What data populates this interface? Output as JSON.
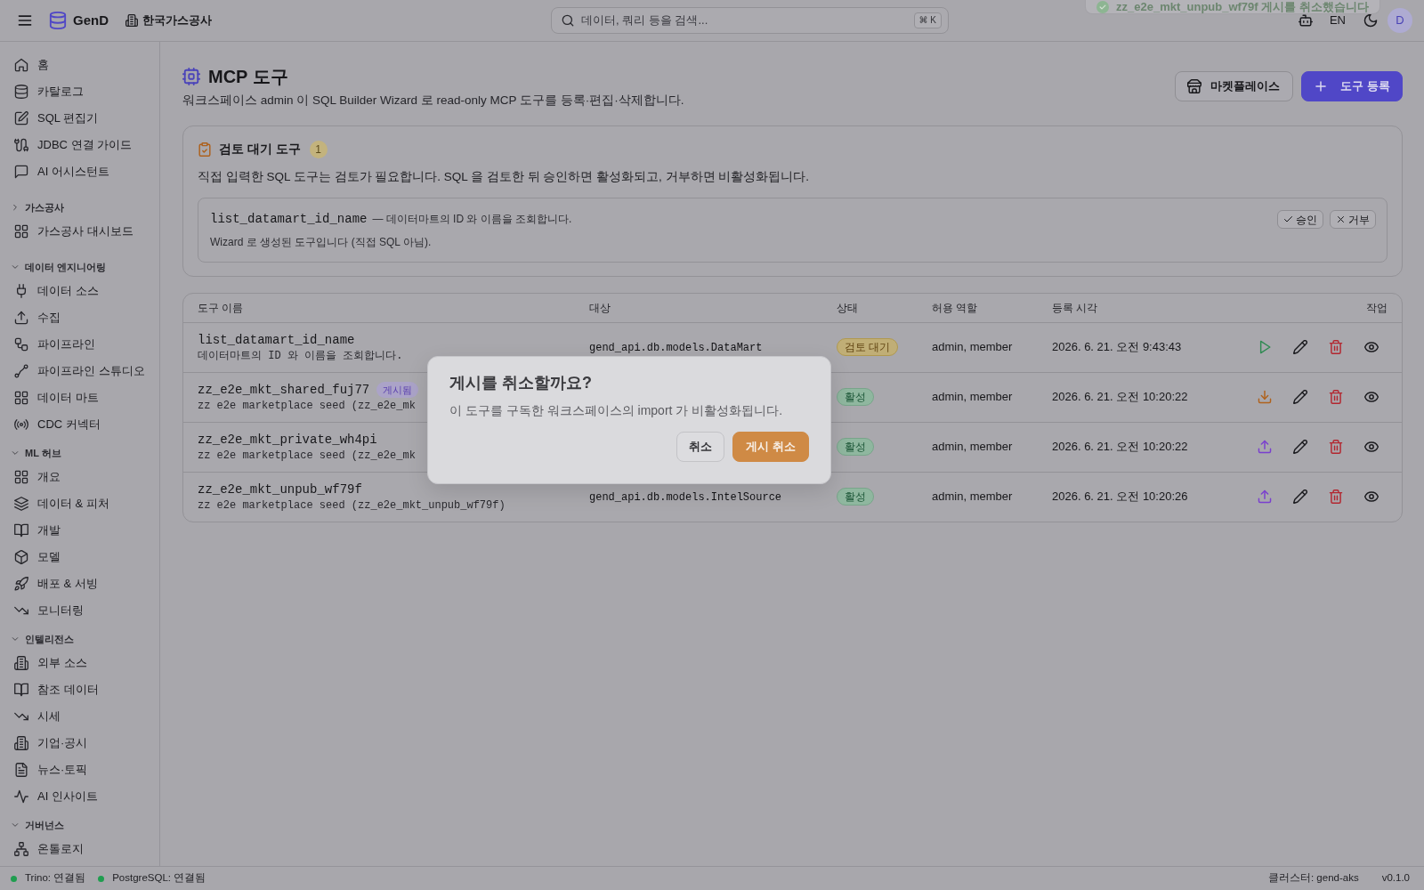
{
  "header": {
    "brand": "GenD",
    "organization": "한국가스공사",
    "search": {
      "placeholder": "데이터, 쿼리 등을 검색...",
      "shortcut": "⌘ K"
    },
    "language": "EN",
    "avatar": "D"
  },
  "toast": {
    "message": "zz_e2e_mkt_unpub_wf79f 게시를 취소했습니다"
  },
  "sidebar": {
    "groups": [
      {
        "items": [
          "홈",
          "카탈로그",
          "SQL 편집기",
          "JDBC 연결 가이드",
          "AI 어시스턴트"
        ]
      },
      {
        "title": "가스공사",
        "expanded": false,
        "items": [
          "가스공사 대시보드"
        ]
      },
      {
        "title": "데이터 엔지니어링",
        "expanded": true,
        "items": [
          "데이터 소스",
          "수집",
          "파이프라인",
          "파이프라인 스튜디오",
          "데이터 마트",
          "CDC 커넥터"
        ]
      },
      {
        "title": "ML 허브",
        "expanded": true,
        "items": [
          "개요",
          "데이터 & 피처",
          "개발",
          "모델",
          "배포 & 서빙",
          "모니터링"
        ]
      },
      {
        "title": "인텔리전스",
        "expanded": true,
        "items": [
          "외부 소스",
          "참조 데이터",
          "시세",
          "기업·공시",
          "뉴스·토픽",
          "AI 인사이트"
        ]
      },
      {
        "title": "거버넌스",
        "expanded": true,
        "items": [
          "온톨로지"
        ]
      }
    ]
  },
  "page": {
    "title": "MCP 도구",
    "subtitle": "워크스페이스 admin 이 SQL Builder Wizard 로 read-only MCP 도구를 등록·편집·삭제합니다.",
    "actions": [
      {
        "label": "마켓플레이스",
        "kind": "outline"
      },
      {
        "label": "도구 등록",
        "kind": "primary"
      }
    ]
  },
  "review": {
    "title": "검토 대기 도구",
    "count": "1",
    "description": "직접 입력한 SQL 도구는 검토가 필요합니다. SQL 을 검토한 뒤 승인하면 활성화되고, 거부하면 비활성화됩니다.",
    "items": [
      {
        "name": "list_datamart_id_name",
        "summary": "— 데이터마트의 ID 와 이름을 조회합니다.",
        "note": "Wizard 로 생성된 도구입니다 (직접 SQL 아님).",
        "approve": "승인",
        "reject": "거부"
      }
    ]
  },
  "table": {
    "columns": [
      "도구 이름",
      "대상",
      "상태",
      "허용 역할",
      "등록 시각",
      "작업"
    ],
    "rows": [
      {
        "name": "list_datamart_id_name",
        "description": "데이터마트의 ID 와 이름을 조회합니다.",
        "target": "gend_api.db.models.DataMart",
        "status": {
          "label": "검토 대기",
          "kind": "pending"
        },
        "roles": "admin, member",
        "registered": "2026. 6. 21. 오전 9:43:43",
        "kind": "run"
      },
      {
        "name": "zz_e2e_mkt_shared_fuj77",
        "badge": "게시됨",
        "description": "zz e2e marketplace seed (zz_e2e_mk",
        "status": {
          "label": "활성",
          "kind": "active"
        },
        "roles": "admin, member",
        "registered": "2026. 6. 21. 오전 10:20:22",
        "kind": "import"
      },
      {
        "name": "zz_e2e_mkt_private_wh4pi",
        "description": "zz e2e marketplace seed (zz_e2e_mk",
        "status": {
          "label": "활성",
          "kind": "active"
        },
        "roles": "admin, member",
        "registered": "2026. 6. 21. 오전 10:20:22",
        "kind": "publish"
      },
      {
        "name": "zz_e2e_mkt_unpub_wf79f",
        "description": "zz e2e marketplace seed (zz_e2e_mkt_unpub_wf79f)",
        "target": "gend_api.db.models.IntelSource",
        "status": {
          "label": "활성",
          "kind": "active"
        },
        "roles": "admin, member",
        "registered": "2026. 6. 21. 오전 10:20:26",
        "kind": "publish"
      }
    ]
  },
  "dialog": {
    "title": "게시를 취소할까요?",
    "message": "이 도구를 구독한 워크스페이스의 import 가 비활성화됩니다.",
    "buttons": [
      {
        "label": "취소",
        "kind": "secondary"
      },
      {
        "label": "게시 취소",
        "kind": "confirm"
      }
    ]
  },
  "status_bar": {
    "connections": [
      {
        "label": "Trino: 연결됨",
        "connected": true
      },
      {
        "label": "PostgreSQL: 연결됨",
        "connected": true
      }
    ],
    "cluster": "클러스터: gend-aks",
    "version": "v0.1.0"
  }
}
